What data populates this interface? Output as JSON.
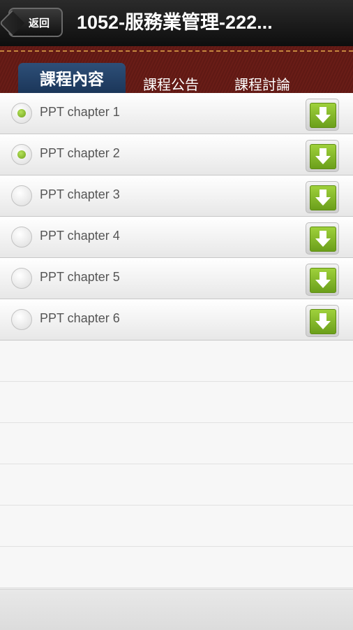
{
  "header": {
    "back_label": "返回",
    "title": "1052-服務業管理-222..."
  },
  "tabs": [
    {
      "label": "課程內容",
      "active": true
    },
    {
      "label": "課程公告",
      "active": false
    },
    {
      "label": "課程討論",
      "active": false
    }
  ],
  "chapters": [
    {
      "label": "PPT chapter 1",
      "viewed": true
    },
    {
      "label": "PPT chapter 2",
      "viewed": true
    },
    {
      "label": "PPT chapter 3",
      "viewed": false
    },
    {
      "label": "PPT chapter 4",
      "viewed": false
    },
    {
      "label": "PPT chapter 5",
      "viewed": false
    },
    {
      "label": "PPT chapter 6",
      "viewed": false
    }
  ],
  "icons": {
    "download": "download-arrow-icon",
    "status": "radio-icon",
    "back": "back-arrow-icon"
  },
  "colors": {
    "active_tab": "#1a3558",
    "tab_bar": "#651b15",
    "download_green": "#7fb527",
    "viewed_dot": "#8cc33a"
  }
}
